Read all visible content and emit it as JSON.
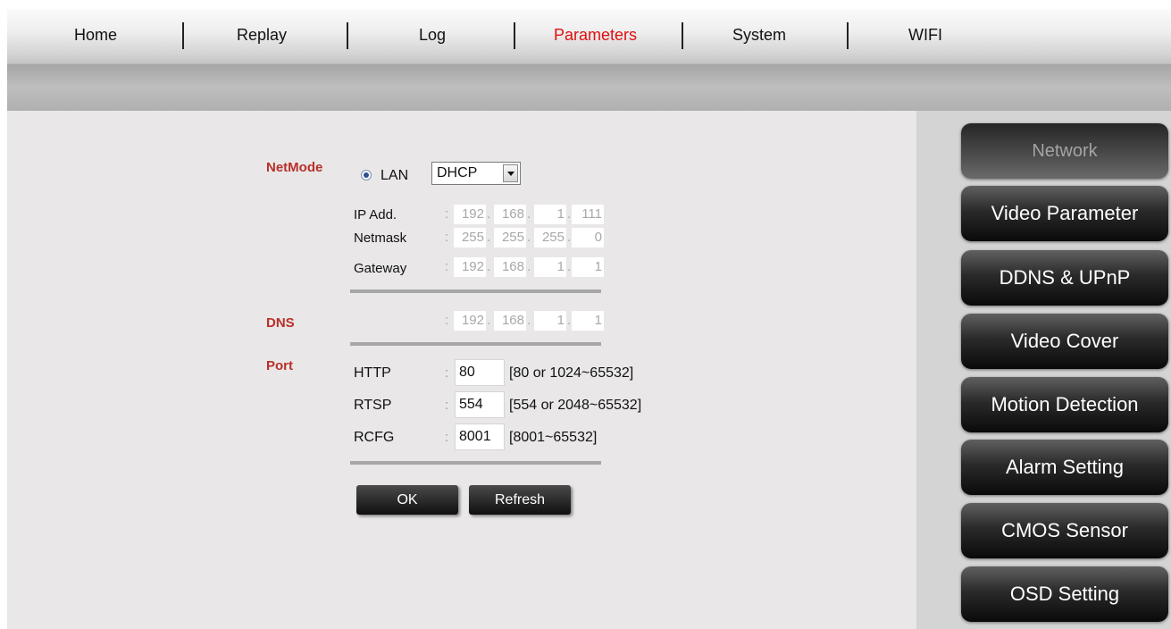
{
  "nav": {
    "items": [
      {
        "label": "Home"
      },
      {
        "label": "Replay"
      },
      {
        "label": "Log"
      },
      {
        "label": "Parameters",
        "active": true
      },
      {
        "label": "System"
      },
      {
        "label": "WIFI"
      }
    ]
  },
  "netmode": {
    "section_label": "NetMode",
    "radio_label": "LAN",
    "select_value": "DHCP",
    "ip_label": "IP Add.",
    "ip": [
      "192",
      "168",
      "1",
      "111"
    ],
    "netmask_label": "Netmask",
    "netmask": [
      "255",
      "255",
      "255",
      "0"
    ],
    "gateway_label": "Gateway",
    "gateway": [
      "192",
      "168",
      "1",
      "1"
    ]
  },
  "dns": {
    "section_label": "DNS",
    "value": [
      "192",
      "168",
      "1",
      "1"
    ]
  },
  "port": {
    "section_label": "Port",
    "rows": [
      {
        "label": "HTTP",
        "value": "80",
        "hint": "[80 or 1024~65532]"
      },
      {
        "label": "RTSP",
        "value": "554",
        "hint": "[554 or 2048~65532]"
      },
      {
        "label": "RCFG",
        "value": "8001",
        "hint": "[8001~65532]"
      }
    ]
  },
  "actions": {
    "ok": "OK",
    "refresh": "Refresh"
  },
  "sidebar": {
    "items": [
      {
        "label": "Network",
        "active": true
      },
      {
        "label": "Video Parameter"
      },
      {
        "label": "DDNS & UPnP"
      },
      {
        "label": "Video Cover"
      },
      {
        "label": "Motion Detection"
      },
      {
        "label": "Alarm Setting"
      },
      {
        "label": "CMOS Sensor"
      },
      {
        "label": "OSD Setting"
      }
    ]
  },
  "colon": ":",
  "dot": "."
}
